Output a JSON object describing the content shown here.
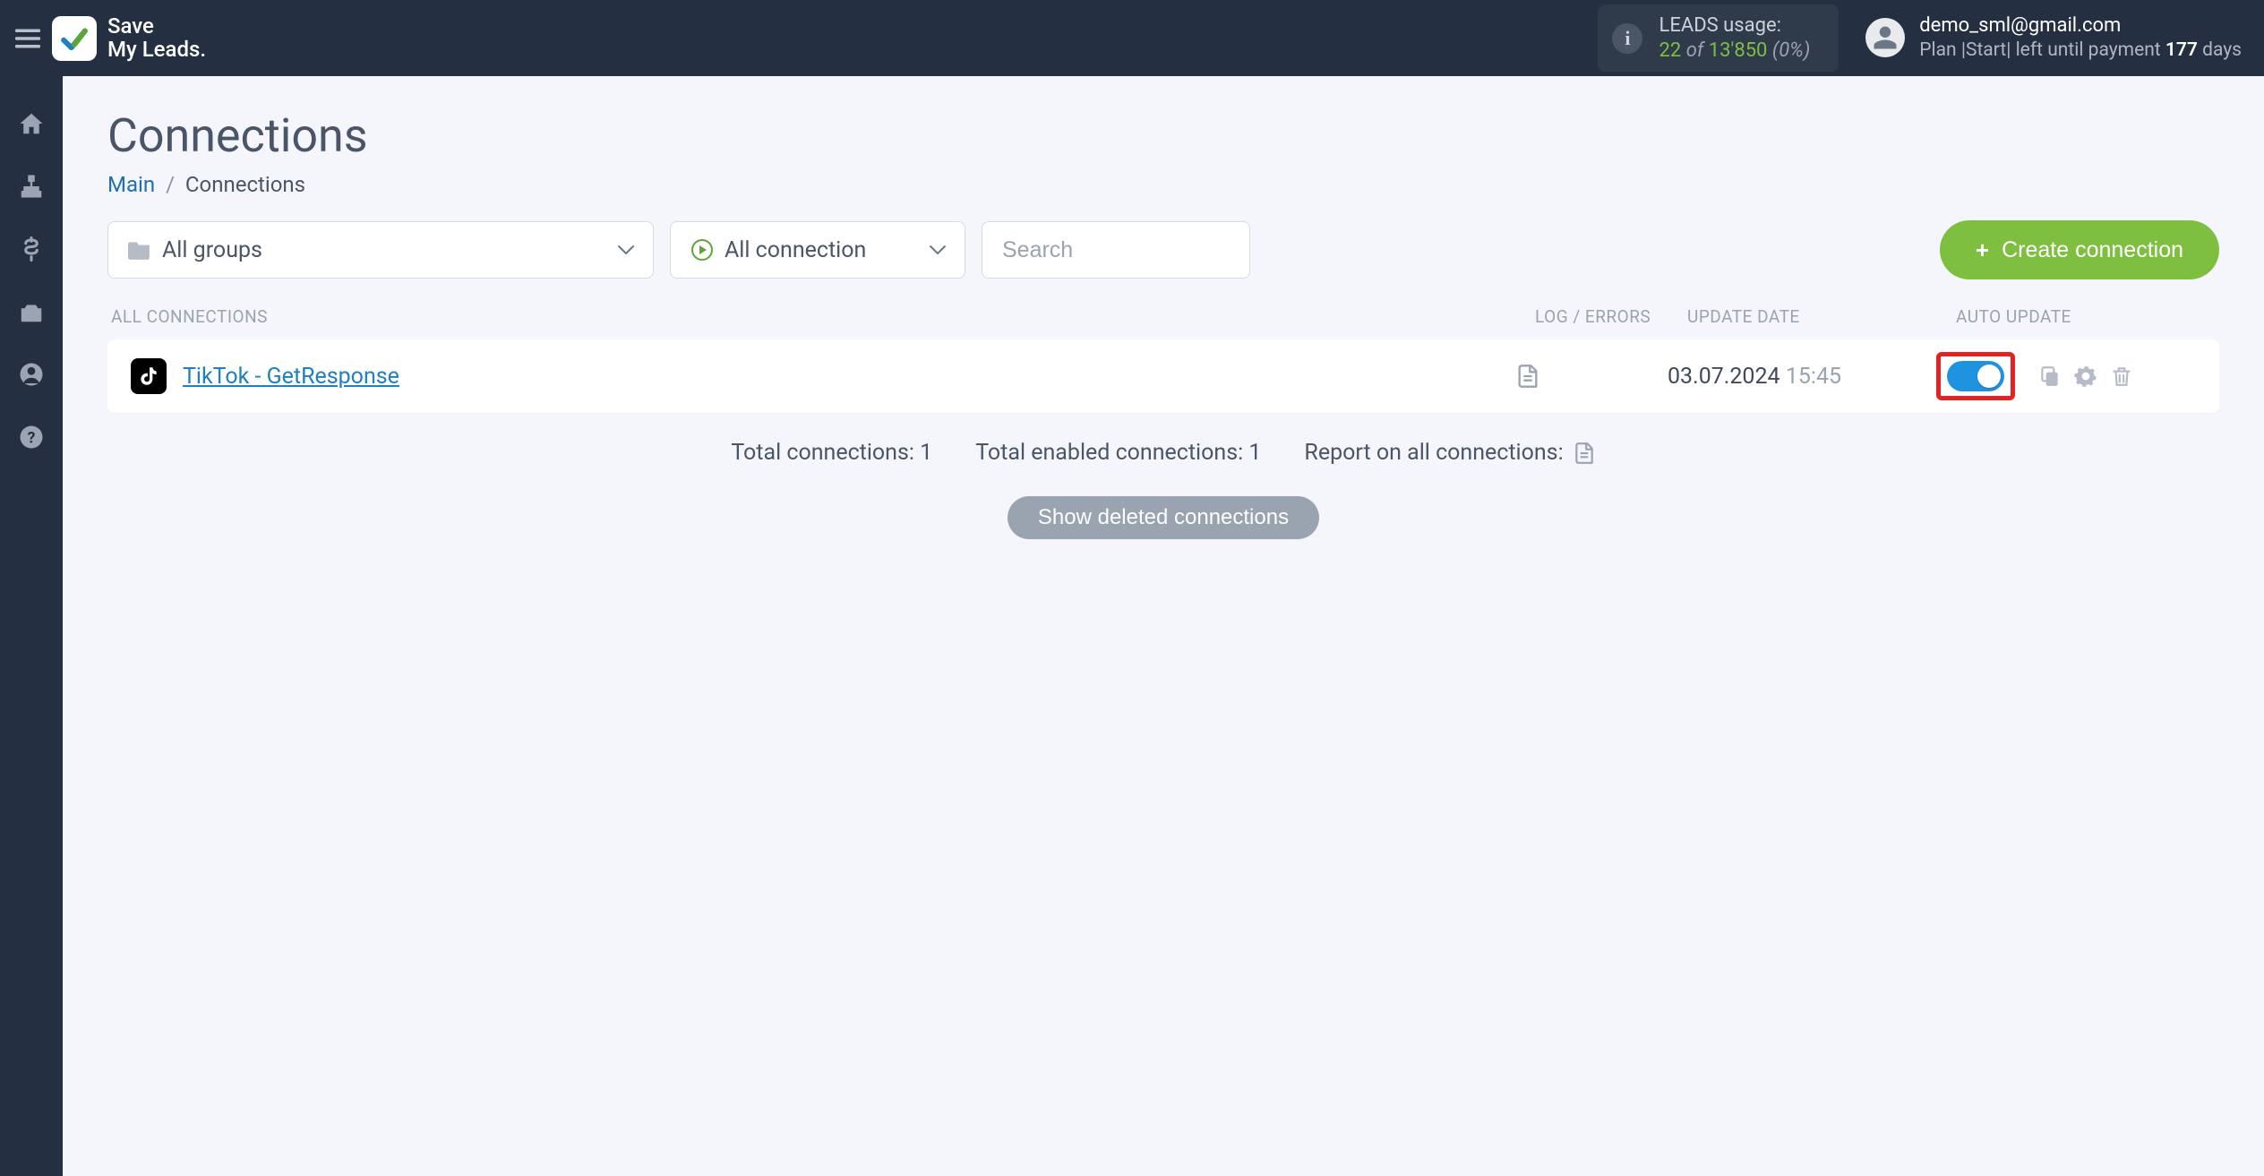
{
  "brand": {
    "line1": "Save",
    "line2": "My Leads."
  },
  "leads": {
    "label": "LEADS usage:",
    "used": "22",
    "of": "of",
    "total": "13'850",
    "pct": "(0%)"
  },
  "user": {
    "email": "demo_sml@gmail.com",
    "plan_prefix": "Plan |",
    "plan_name": "Start",
    "plan_mid": "| left until payment ",
    "days": "177",
    "days_suffix": " days"
  },
  "page": {
    "title": "Connections"
  },
  "breadcrumb": {
    "main": "Main",
    "sep": "/",
    "current": "Connections"
  },
  "filters": {
    "groups_label": "All groups",
    "status_label": "All connection",
    "search_placeholder": "Search"
  },
  "buttons": {
    "create": "Create connection",
    "show_deleted": "Show deleted connections"
  },
  "columns": {
    "all": "All connections",
    "log": "Log / Errors",
    "date": "Update date",
    "auto": "Auto update"
  },
  "rows": [
    {
      "name": "TikTok - GetResponse",
      "date": "03.07.2024",
      "time": "15:45",
      "auto": true
    }
  ],
  "totals": {
    "total_label": "Total connections: ",
    "total_val": "1",
    "enabled_label": "Total enabled connections: ",
    "enabled_val": "1",
    "report_label": "Report on all connections:"
  }
}
